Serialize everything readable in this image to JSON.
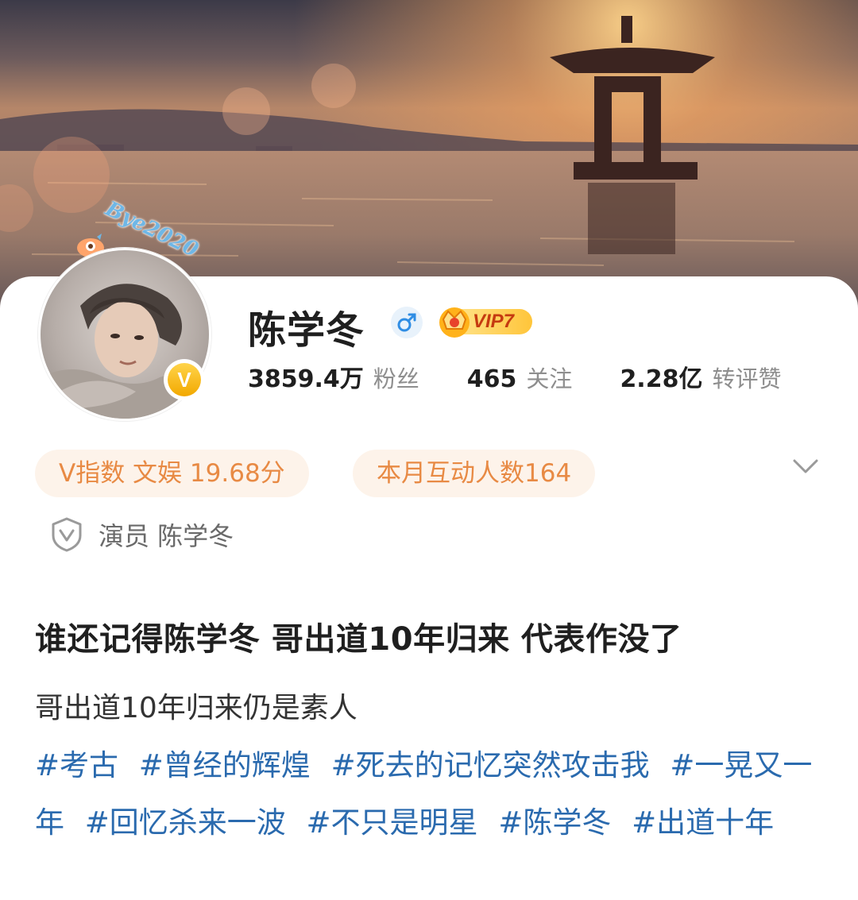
{
  "cover": {
    "description_icon": "sunset-lake-pagoda"
  },
  "avatar": {
    "frame_text": "Bye2020",
    "badge_letter": "V"
  },
  "profile": {
    "name": "陈学冬",
    "vip_label": "VIP7",
    "stats": [
      {
        "value": "3859.4万",
        "label": "粉丝"
      },
      {
        "value": "465",
        "label": "关注"
      },
      {
        "value": "2.28亿",
        "label": "转评赞"
      }
    ],
    "v_index": "V指数 文娱 19.68分",
    "monthly_interactions": "本月互动人数164",
    "certification": "演员 陈学冬"
  },
  "post": {
    "title": "谁还记得陈学冬 哥出道10年归来 代表作没了",
    "subtitle": "哥出道10年归来仍是素人",
    "tags": [
      "#考古",
      "#曾经的辉煌",
      "#死去的记忆突然攻击我",
      "#一晃又一年",
      "#回忆杀来一波",
      "#不只是明星",
      "#陈学冬",
      "#出道十年"
    ]
  },
  "colors": {
    "link": "#2a6aae",
    "pill_text": "#e88a44",
    "pill_bg": "#fdf3ea",
    "vip_text": "#c53a10"
  }
}
